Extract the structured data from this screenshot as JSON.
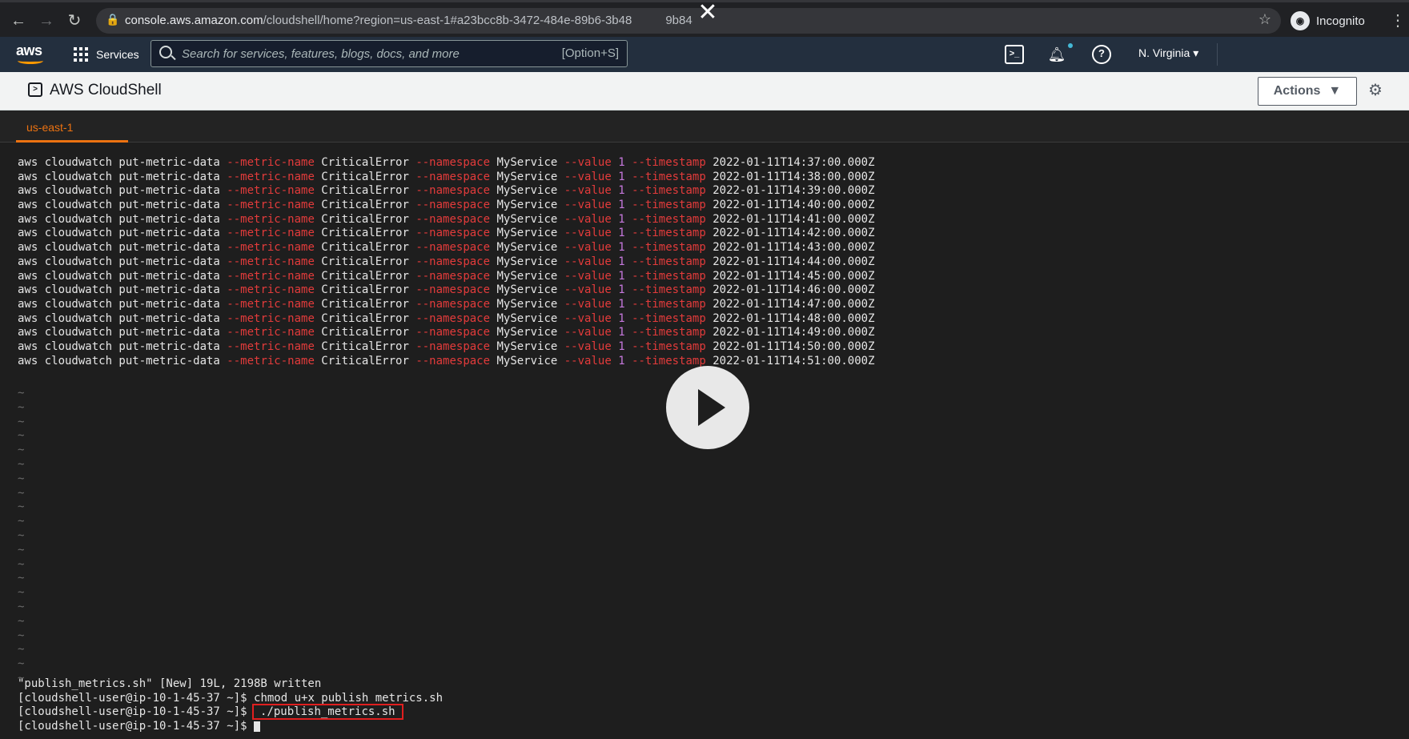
{
  "browser": {
    "url_host": "console.aws.amazon.com",
    "url_path": "/cloudshell/home?region=us-east-1#a23bcc8b-3472-484e-89b6-3b48",
    "url_tail": "9b84",
    "profile_label": "Incognito"
  },
  "aws_nav": {
    "logo_text": "aws",
    "services_label": "Services",
    "search_placeholder": "Search for services, features, blogs, docs, and more",
    "search_shortcut": "[Option+S]",
    "region_label": "N. Virginia ▾"
  },
  "cloudshell": {
    "title": "AWS CloudShell",
    "actions_label": "Actions",
    "tab_label": "us-east-1"
  },
  "terminal": {
    "cmd_prefix": "aws cloudwatch put-metric-data ",
    "opt_metric": "--metric-name",
    "metric_name": " CriticalError ",
    "opt_namespace": "--namespace",
    "namespace": " MyService ",
    "opt_value": "--value",
    "value": " 1 ",
    "opt_timestamp": "--timestamp",
    "timestamps": [
      " 2022-01-11T14:37:00.000Z",
      " 2022-01-11T14:38:00.000Z",
      " 2022-01-11T14:39:00.000Z",
      " 2022-01-11T14:40:00.000Z",
      " 2022-01-11T14:41:00.000Z",
      " 2022-01-11T14:42:00.000Z",
      " 2022-01-11T14:43:00.000Z",
      " 2022-01-11T14:44:00.000Z",
      " 2022-01-11T14:45:00.000Z",
      " 2022-01-11T14:46:00.000Z",
      " 2022-01-11T14:47:00.000Z",
      " 2022-01-11T14:48:00.000Z",
      " 2022-01-11T14:49:00.000Z",
      " 2022-01-11T14:50:00.000Z",
      " 2022-01-11T14:51:00.000Z"
    ],
    "tilde": "~",
    "write_status": "\"publish_metrics.sh\" [New] 19L, 2198B written",
    "prompt": "[cloudshell-user@ip-10-1-45-37 ~]$ ",
    "chmod_cmd": "chmod u+x publish_metrics.sh",
    "run_cmd": "./publish_metrics.sh"
  }
}
